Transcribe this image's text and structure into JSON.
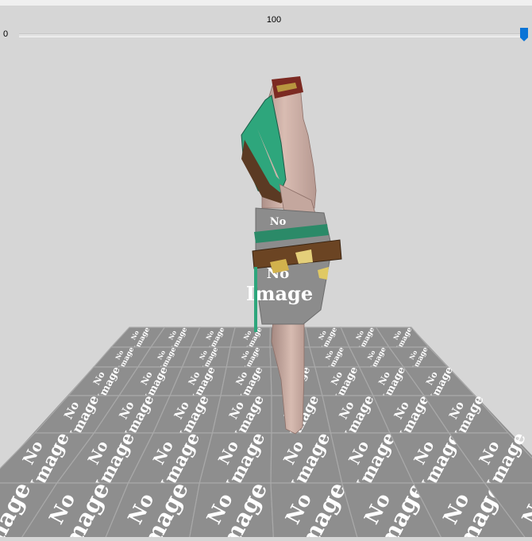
{
  "slider": {
    "value_label": "100",
    "min_label": "0",
    "value": 100,
    "min": 0,
    "max": 100,
    "thumb_color": "#0a74d6"
  },
  "viewport": {
    "background_color": "#d6d6d6",
    "floor_tile_text_line1": "No",
    "floor_tile_text_line2": "Image",
    "floor_color": "#8e8e8e",
    "model_placeholder_text_line1": "No",
    "model_placeholder_text_line2": "Image"
  }
}
